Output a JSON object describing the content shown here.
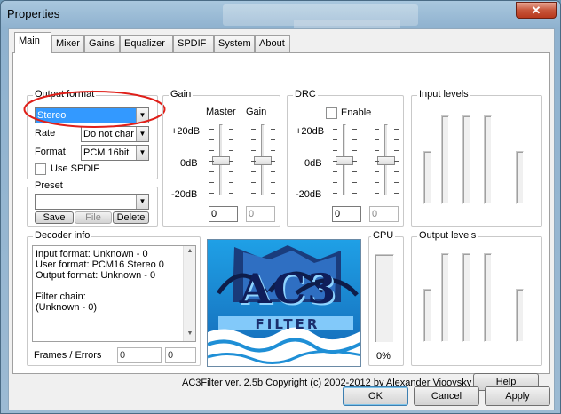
{
  "window": {
    "title": "Properties",
    "close_glyph": "✕"
  },
  "tabs": [
    {
      "label": "Main",
      "active": true
    },
    {
      "label": "Mixer"
    },
    {
      "label": "Gains"
    },
    {
      "label": "Equalizer"
    },
    {
      "label": "SPDIF"
    },
    {
      "label": "System"
    },
    {
      "label": "About"
    }
  ],
  "output_format": {
    "group_label": "Output format",
    "format_value": "Stereo",
    "rate_label": "Rate",
    "rate_value": "Do not char",
    "format_label": "Format",
    "sample_format_value": "PCM 16bit",
    "use_spdif_label": "Use SPDIF",
    "use_spdif_checked": false
  },
  "preset": {
    "group_label": "Preset",
    "value": "",
    "save_label": "Save",
    "file_label": "File",
    "delete_label": "Delete"
  },
  "gain": {
    "group_label": "Gain",
    "master_label": "Master",
    "gain_label": "Gain",
    "plus_label": "+20dB",
    "zero_label": "0dB",
    "minus_label": "-20dB",
    "master_value": "0",
    "gain_value": "0"
  },
  "drc": {
    "group_label": "DRC",
    "enable_label": "Enable",
    "enable_checked": false,
    "plus_label": "+20dB",
    "zero_label": "0dB",
    "minus_label": "-20dB",
    "value1": "0",
    "value2": "0"
  },
  "input_levels": {
    "group_label": "Input levels"
  },
  "output_levels": {
    "group_label": "Output levels"
  },
  "decoder": {
    "group_label": "Decoder info",
    "lines": [
      "Input format: Unknown - 0",
      "User format: PCM16 Stereo 0",
      "Output format: Unknown - 0",
      "",
      "Filter chain:",
      "(Unknown - 0)"
    ],
    "frames_label": "Frames / Errors",
    "frames_value": "0",
    "errors_value": "0"
  },
  "cpu": {
    "label": "CPU",
    "value": "0%"
  },
  "logo": {
    "text": "AC3",
    "subtext": "FILTER"
  },
  "copyright": "AC3Filter ver. 2.5b Copyright (c) 2002-2012 by Alexander Vigovsky",
  "help_label": "Help",
  "buttons": {
    "ok": "OK",
    "cancel": "Cancel",
    "apply": "Apply"
  },
  "colors": {
    "highlight": "#3399ff",
    "annotation_red": "#e0201a",
    "logo_bg": "#1f8fd6"
  }
}
